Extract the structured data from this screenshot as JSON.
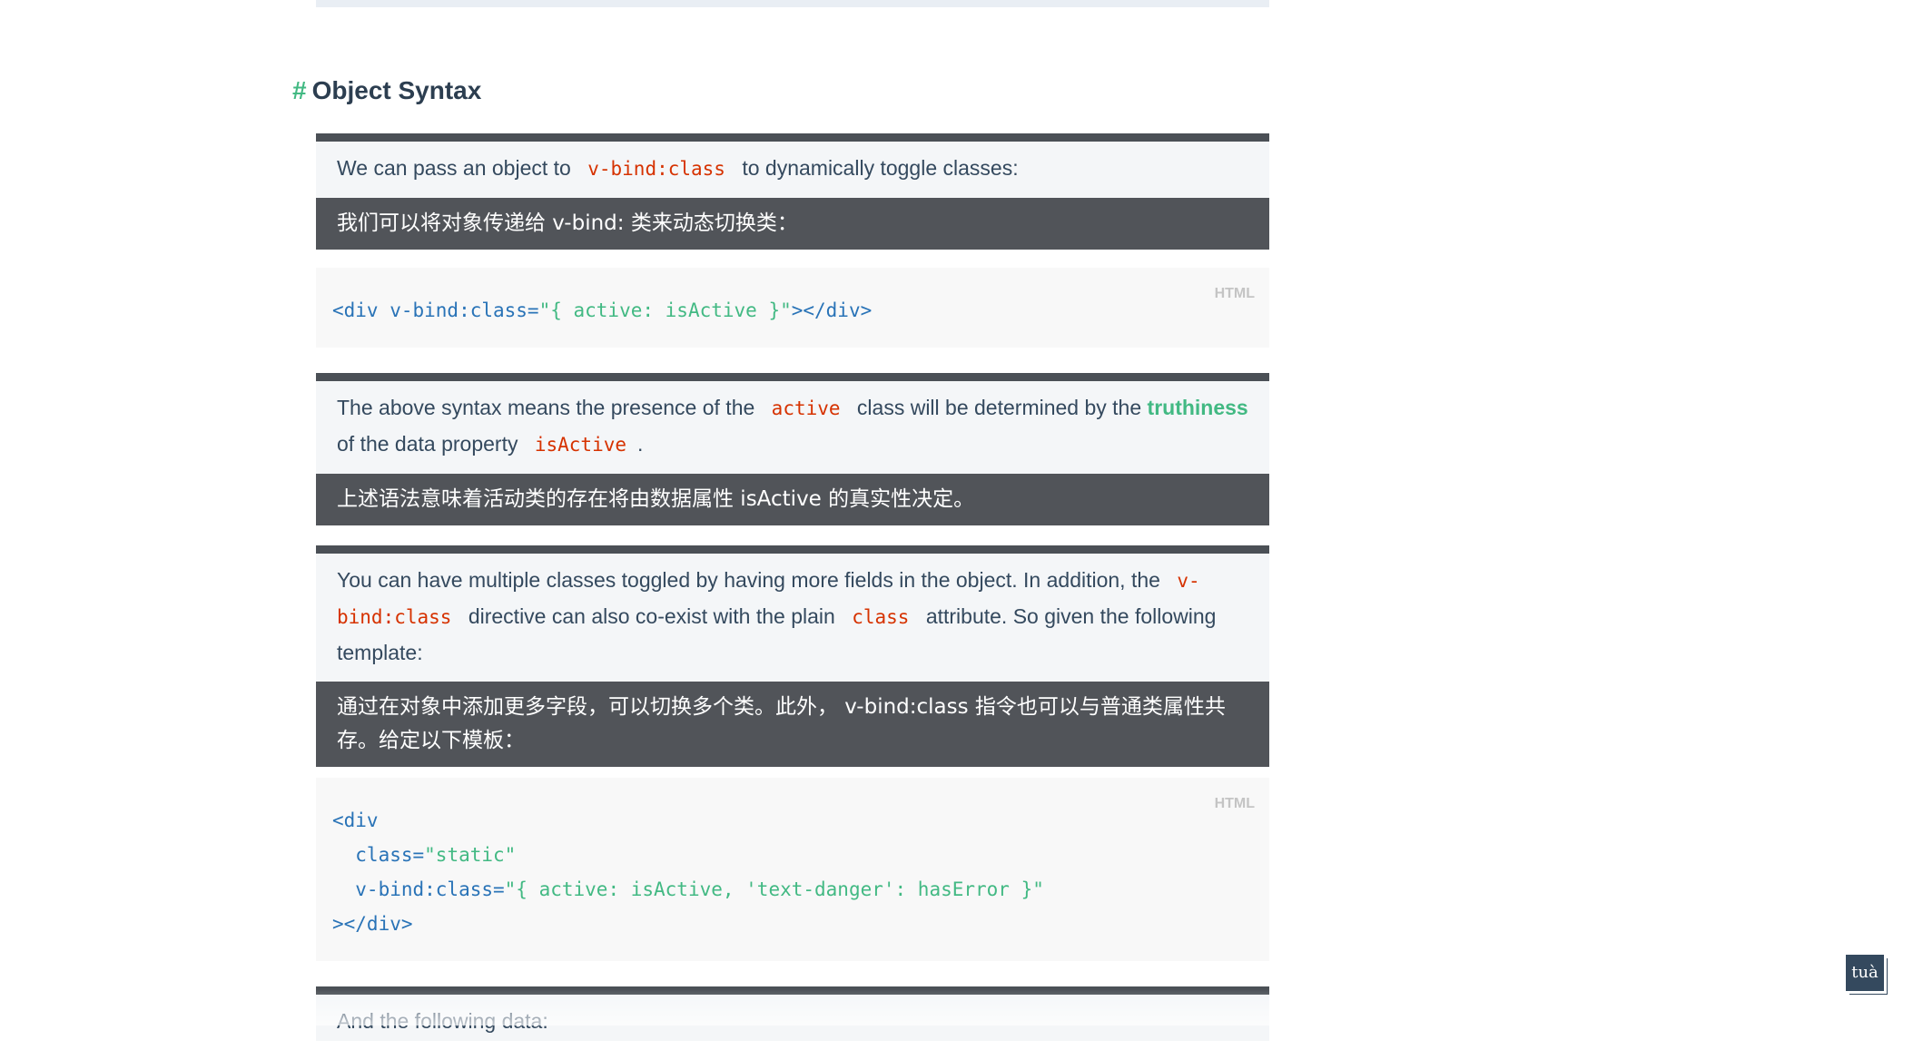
{
  "heading": {
    "hash": "#",
    "title": "Object Syntax"
  },
  "block1": {
    "en_a": "We can pass an object to",
    "en_code": "v-bind:class",
    "en_b": "to dynamically toggle classes:",
    "zh": "我们可以将对象传递给 v-bind: 类来动态切换类："
  },
  "code1": {
    "lang": "HTML",
    "p1": "<div v-bind:class=",
    "p2": "\"{ active: isActive }\"",
    "p3": "></div>"
  },
  "block2": {
    "en_a": "The above syntax means the presence of the",
    "en_code1": "active",
    "en_b": "class will be determined by the",
    "en_link": "truthiness",
    "en_c": "of the data property",
    "en_code2": "isActive",
    "en_d": ".",
    "zh": "上述语法意味着活动类的存在将由数据属性 isActive 的真实性决定。"
  },
  "block3": {
    "en_a": "You can have multiple classes toggled by having more fields in the object. In addition, the",
    "en_code1": "v-bind:class",
    "en_b": "directive can also co-exist with the plain",
    "en_code2": "class",
    "en_c": "attribute. So given the following template:",
    "zh": "通过在对象中添加更多字段，可以切换多个类。此外， v-bind:class 指令也可以与普通类属性共存。给定以下模板："
  },
  "code2": {
    "lang": "HTML",
    "l1": "<div",
    "l2a": "  class=",
    "l2b": "\"static\"",
    "l3a": "  v-bind:class=",
    "l3b": "\"{ active: isActive, 'text-danger': hasError }\"",
    "l4": "></div>"
  },
  "block4": {
    "en": "And the following data:"
  },
  "widget": {
    "label": "tuà"
  }
}
